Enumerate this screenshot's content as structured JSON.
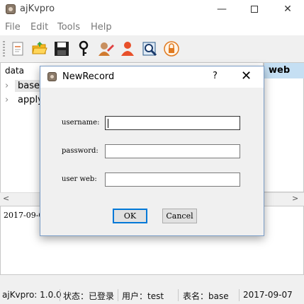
{
  "window": {
    "title": "ajKvpro",
    "min_glyph": "—",
    "close_glyph": "✕"
  },
  "menu": [
    "File",
    "Edit",
    "Tools",
    "Help"
  ],
  "toolbar": [
    "new-record-icon",
    "open-folder-icon",
    "save-disk-icon",
    "key-icon",
    "user-edit-icon",
    "user-icon",
    "search-document-icon",
    "lock-icon"
  ],
  "tree": {
    "header": "data",
    "items": [
      {
        "label": "base",
        "expanded": false
      },
      {
        "label": "apply",
        "expanded": false
      }
    ]
  },
  "right_header": "web",
  "log": {
    "line": "2017-09-0"
  },
  "dialog": {
    "title": "NewRecord",
    "help": "?",
    "close": "✕",
    "fields": [
      {
        "label": "username:",
        "value": ""
      },
      {
        "label": "password:",
        "value": ""
      },
      {
        "label": "user web:",
        "value": ""
      }
    ],
    "ok": "OK",
    "cancel": "Cancel"
  },
  "status": {
    "version": "ajKvpro: 1.0.0",
    "state": "状态：已登录",
    "user": "用户：test",
    "table": "表名：base",
    "date": "2017-09-07"
  }
}
